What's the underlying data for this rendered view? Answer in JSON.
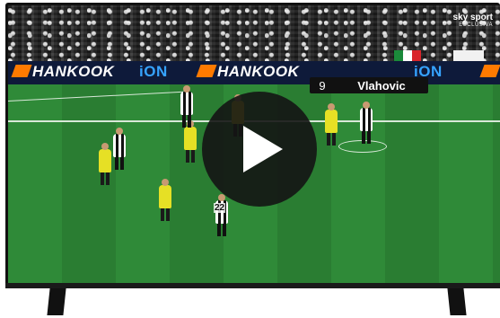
{
  "broadcaster": {
    "name": "sky sport",
    "tag": "ESCLUSIVA"
  },
  "ads": {
    "brand1": "HANKOOK",
    "brand2": "iON"
  },
  "scorebug": {
    "number": "9",
    "player": "Vlahovic"
  },
  "players": {
    "juve_number": "22"
  },
  "play_button": {
    "icon": "play-icon"
  },
  "colors": {
    "pitch": "#2f8a38",
    "yellow_kit": "#e6e025",
    "overlay": "#141414"
  }
}
